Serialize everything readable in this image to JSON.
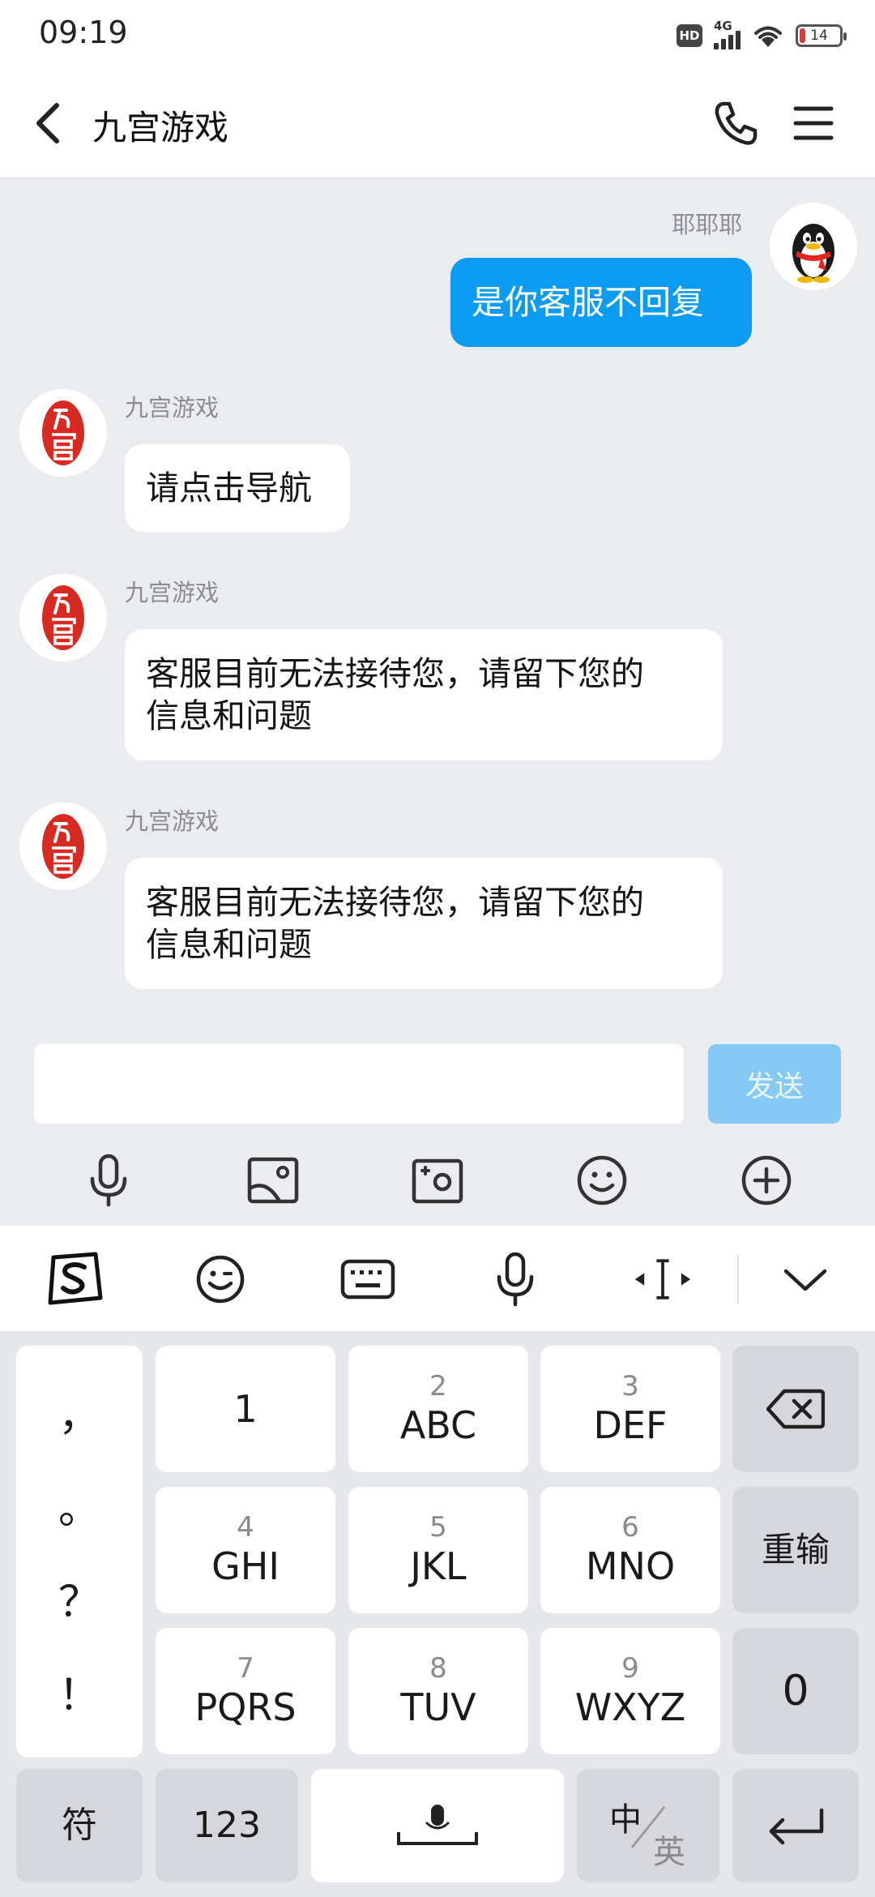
{
  "status_bar": {
    "time": "09:19",
    "hd": "HD",
    "network": "4G",
    "battery": "14",
    "battery_level": 0.14
  },
  "header": {
    "title": "九宫游戏",
    "back_icon": "chevron-left-icon",
    "phone_icon": "phone-icon",
    "menu_icon": "menu-icon"
  },
  "messages": [
    {
      "direction": "out",
      "sender": "耶耶耶",
      "text": "是你客服不回复"
    },
    {
      "direction": "in",
      "sender": "九宫游戏",
      "text": "请点击导航"
    },
    {
      "direction": "in",
      "sender": "九宫游戏",
      "lines": [
        "客服目前无法接待您，请留下您的",
        "信息和问题"
      ]
    },
    {
      "direction": "in",
      "sender": "九宫游戏",
      "lines": [
        "客服目前无法接待您，请留下您的",
        "信息和问题"
      ]
    }
  ],
  "input": {
    "value": "",
    "send_label": "发送"
  },
  "toolbar_icons": [
    "microphone-icon",
    "image-icon",
    "camera-icon",
    "emoji-icon",
    "plus-icon"
  ],
  "keyboard": {
    "topbar_icons": [
      "sogou-logo-icon",
      "emoji-icon",
      "keyboard-icon",
      "microphone-icon",
      "cursor-move-icon",
      "collapse-icon"
    ],
    "punctuation": [
      "，",
      "。",
      "？",
      "！"
    ],
    "keys": [
      {
        "num": "",
        "letters": "1"
      },
      {
        "num": "2",
        "letters": "ABC"
      },
      {
        "num": "3",
        "letters": "DEF"
      },
      {
        "num": "4",
        "letters": "GHI"
      },
      {
        "num": "5",
        "letters": "JKL"
      },
      {
        "num": "6",
        "letters": "MNO"
      },
      {
        "num": "7",
        "letters": "PQRS"
      },
      {
        "num": "8",
        "letters": "TUV"
      },
      {
        "num": "9",
        "letters": "WXYZ"
      }
    ],
    "reenter": "重输",
    "zero": "0",
    "symbols": "符",
    "numbers": "123",
    "lang_zh": "中",
    "lang_en": "英"
  },
  "colors": {
    "accent": "#0b9cf1",
    "send_disabled": "#85c9f5",
    "battery_low": "#e53935"
  }
}
